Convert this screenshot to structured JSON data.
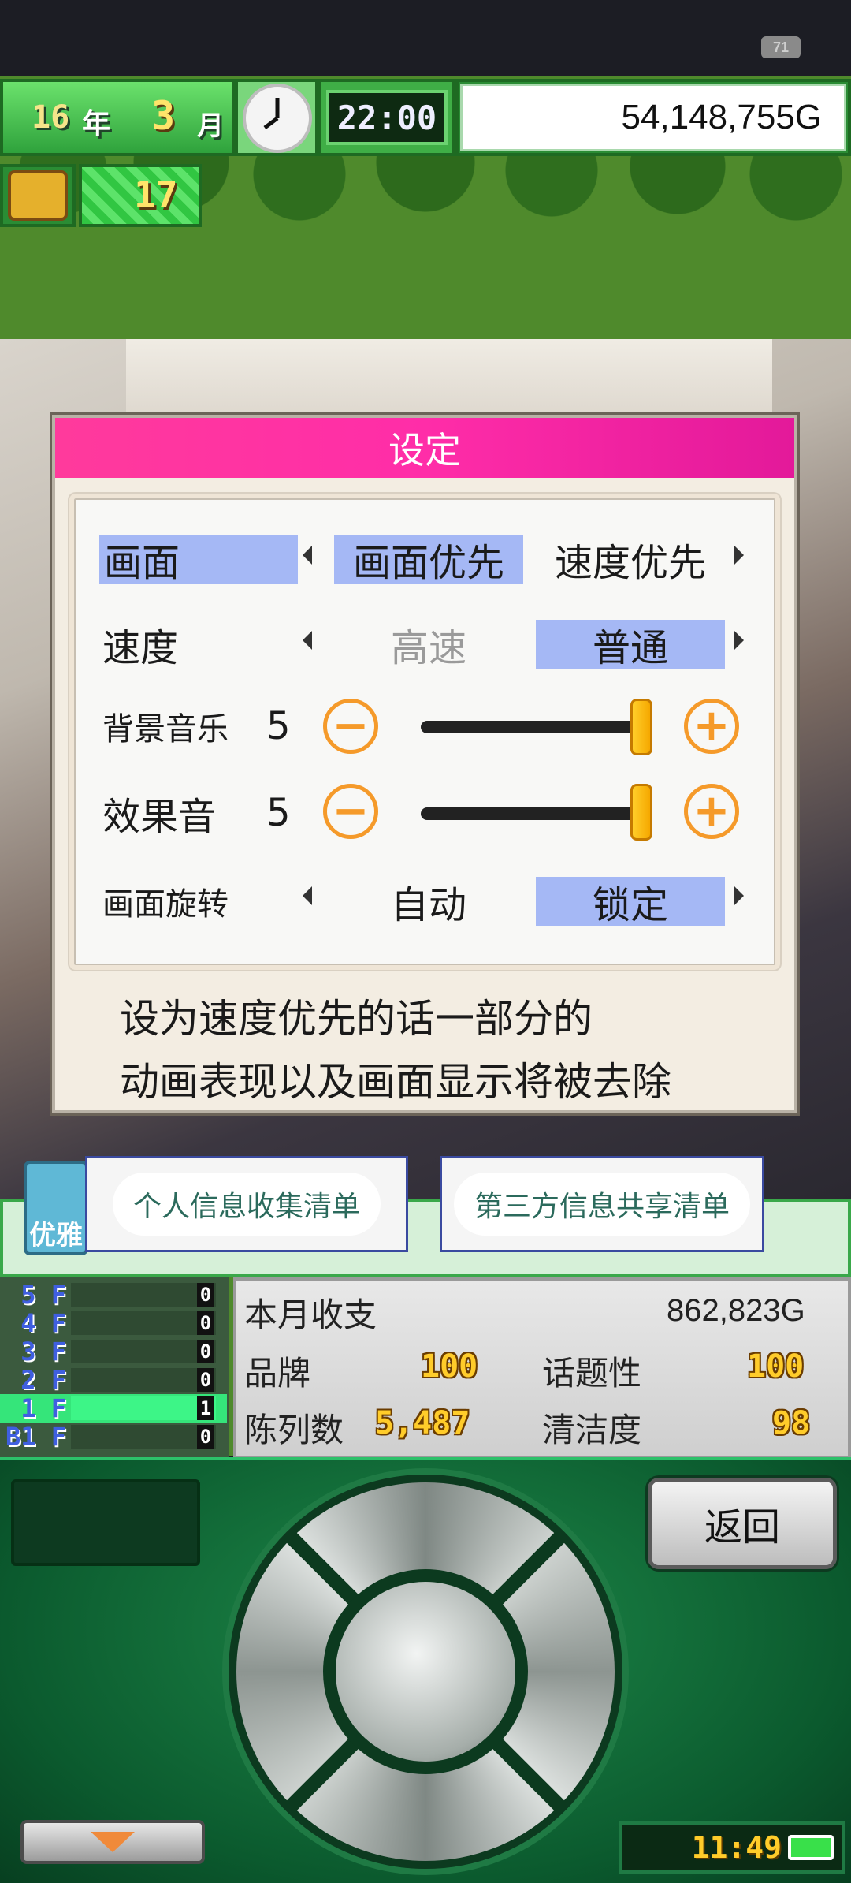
{
  "status_bar": {
    "battery": "71"
  },
  "hud": {
    "year": "16",
    "year_unit": "年",
    "month": "3",
    "month_unit": "月",
    "time": "22:00",
    "money": "54,148,755G",
    "count": "17"
  },
  "dialog": {
    "title": "设定",
    "rows": [
      {
        "label": "画面",
        "options": [
          "画面优先",
          "速度优先"
        ],
        "selected": "画面优先"
      },
      {
        "label": "速度",
        "options": [
          "高速",
          "普通"
        ],
        "selected": "普通"
      },
      {
        "label": "画面旋转",
        "options": [
          "自动",
          "锁定"
        ],
        "selected": "锁定"
      }
    ],
    "bgm": {
      "label": "背景音乐",
      "value": "5",
      "level": 1.0
    },
    "se": {
      "label": "效果音",
      "value": "5",
      "level": 1.0
    },
    "minus_glyph": "−",
    "plus_glyph": "+",
    "description": [
      "设为速度优先的话一部分的",
      "动画表现以及画面显示将被去除"
    ]
  },
  "privacy": {
    "personal_info": "个人信息收集清单",
    "third_party": "第三方信息共享清单",
    "category_label": "优雅"
  },
  "floors": [
    {
      "label": "5 F",
      "value": "0"
    },
    {
      "label": "4 F",
      "value": "0"
    },
    {
      "label": "3 F",
      "value": "0"
    },
    {
      "label": "2 F",
      "value": "0"
    },
    {
      "label": "1 F",
      "value": "1"
    },
    {
      "label": "B1 F",
      "value": "0"
    }
  ],
  "stats": {
    "monthly_label": "本月收支",
    "monthly_value": "862,823G",
    "brand_label": "品牌",
    "brand_value": "100",
    "topic_label": "话题性",
    "topic_value": "100",
    "display_label": "陈列数",
    "display_value": "5,487",
    "clean_label": "清洁度",
    "clean_value": "98"
  },
  "controls": {
    "back": "返回",
    "clock": "11:49"
  },
  "colors": {
    "title_bar": "#ff2da8",
    "selected": "#a5b8f5",
    "accent_orange": "#f59a2a"
  }
}
